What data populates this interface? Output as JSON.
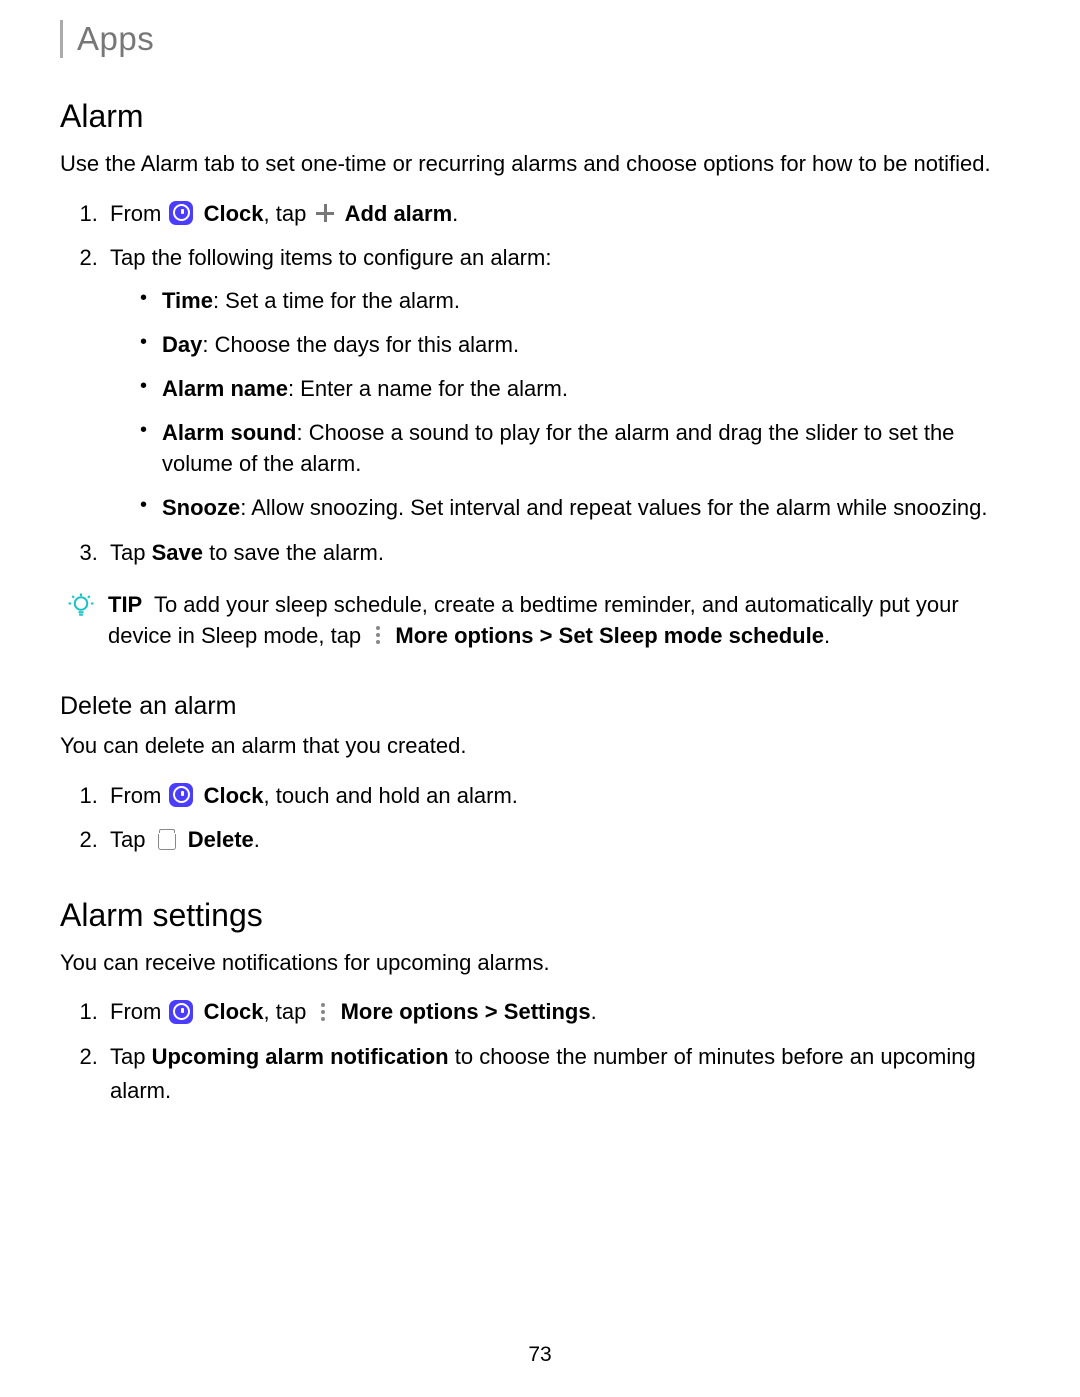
{
  "header": {
    "breadcrumb": "Apps"
  },
  "alarm": {
    "title": "Alarm",
    "intro": "Use the Alarm tab to set one-time or recurring alarms and choose options for how to be notified.",
    "step1_from": "From",
    "step1_clock": "Clock",
    "step1_tap": ", tap",
    "step1_addalarm": "Add alarm",
    "step1_dot": ".",
    "step2": "Tap the following items to configure an alarm:",
    "items": {
      "time_b": "Time",
      "time_t": ": Set a time for the alarm.",
      "day_b": "Day",
      "day_t": ": Choose the days for this alarm.",
      "name_b": "Alarm name",
      "name_t": ": Enter a name for the alarm.",
      "sound_b": "Alarm sound",
      "sound_t": ": Choose a sound to play for the alarm and drag the slider to set the volume of the alarm.",
      "snooze_b": "Snooze",
      "snooze_t": ": Allow snoozing. Set interval and repeat values for the alarm while snoozing."
    },
    "step3_a": "Tap ",
    "step3_b": "Save",
    "step3_c": " to save the alarm."
  },
  "tip": {
    "label": "TIP",
    "text_a": "To add your sleep schedule, create a bedtime reminder, and automatically put your device in Sleep mode, tap",
    "more": "More options",
    "gt": ">",
    "set": "Set Sleep mode schedule",
    "dot": "."
  },
  "delete": {
    "title": "Delete an alarm",
    "intro": "You can delete an alarm that you created.",
    "s1_from": "From",
    "s1_clock": "Clock",
    "s1_rest": ", touch and hold an alarm.",
    "s2_tap": "Tap",
    "s2_delete": "Delete",
    "s2_dot": "."
  },
  "settings": {
    "title": "Alarm settings",
    "intro": "You can receive notifications for upcoming alarms.",
    "s1_from": "From",
    "s1_clock": "Clock",
    "s1_tap": ", tap",
    "s1_more": "More options",
    "s1_gt": ">",
    "s1_settings": "Settings",
    "s1_dot": ".",
    "s2_a": "Tap ",
    "s2_b": "Upcoming alarm notification",
    "s2_c": " to choose the number of minutes before an upcoming alarm."
  },
  "page_number": "73"
}
